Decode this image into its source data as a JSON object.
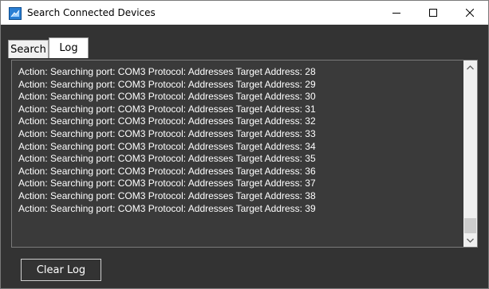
{
  "window": {
    "title": "Search Connected Devices"
  },
  "tabs": [
    {
      "label": "Search",
      "selected": false
    },
    {
      "label": "Log",
      "selected": true
    }
  ],
  "log": {
    "lines": [
      "Action: Searching port: COM3 Protocol: Addresses Target Address: 28",
      "Action: Searching port: COM3 Protocol: Addresses Target Address: 29",
      "Action: Searching port: COM3 Protocol: Addresses Target Address: 30",
      "Action: Searching port: COM3 Protocol: Addresses Target Address: 31",
      "Action: Searching port: COM3 Protocol: Addresses Target Address: 32",
      "Action: Searching port: COM3 Protocol: Addresses Target Address: 33",
      "Action: Searching port: COM3 Protocol: Addresses Target Address: 34",
      "Action: Searching port: COM3 Protocol: Addresses Target Address: 35",
      "Action: Searching port: COM3 Protocol: Addresses Target Address: 36",
      "Action: Searching port: COM3 Protocol: Addresses Target Address: 37",
      "Action: Searching port: COM3 Protocol: Addresses Target Address: 38",
      "Action: Searching port: COM3 Protocol: Addresses Target Address: 39"
    ]
  },
  "buttons": {
    "clear_log": "Clear Log"
  },
  "icons": {
    "app": "app-icon",
    "minimize": "minimize-icon",
    "maximize": "maximize-icon",
    "close": "close-icon",
    "scroll_up": "chevron-up-icon",
    "scroll_down": "chevron-down-icon"
  },
  "colors": {
    "body_background": "#333333",
    "log_background": "#3a3a3a",
    "log_text": "#ffffff"
  }
}
